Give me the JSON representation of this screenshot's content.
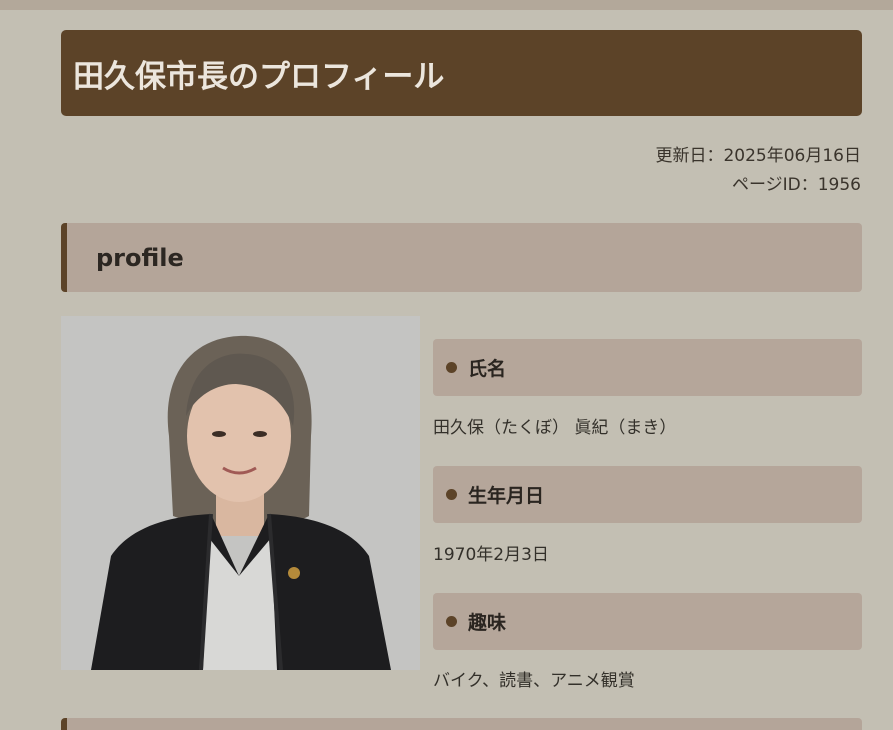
{
  "page": {
    "title": "田久保市長のプロフィール",
    "updated": "更新日：2025年06月16日",
    "page_id": "ページID：1956"
  },
  "section": {
    "heading": "profile"
  },
  "profile": {
    "fields": [
      {
        "label": "氏名",
        "value": "田久保（たくぼ） 眞紀（まき）"
      },
      {
        "label": "生年月日",
        "value": "1970年2月3日"
      },
      {
        "label": "趣味",
        "value": "バイク、読書、アニメ観賞"
      }
    ]
  },
  "colors": {
    "background": "#c3bfb3",
    "title_bar": "#5c4328",
    "section_bg": "#b4a599",
    "accent": "#5c4328"
  },
  "icons": {
    "field_bullet": "bullet-dot-icon"
  }
}
